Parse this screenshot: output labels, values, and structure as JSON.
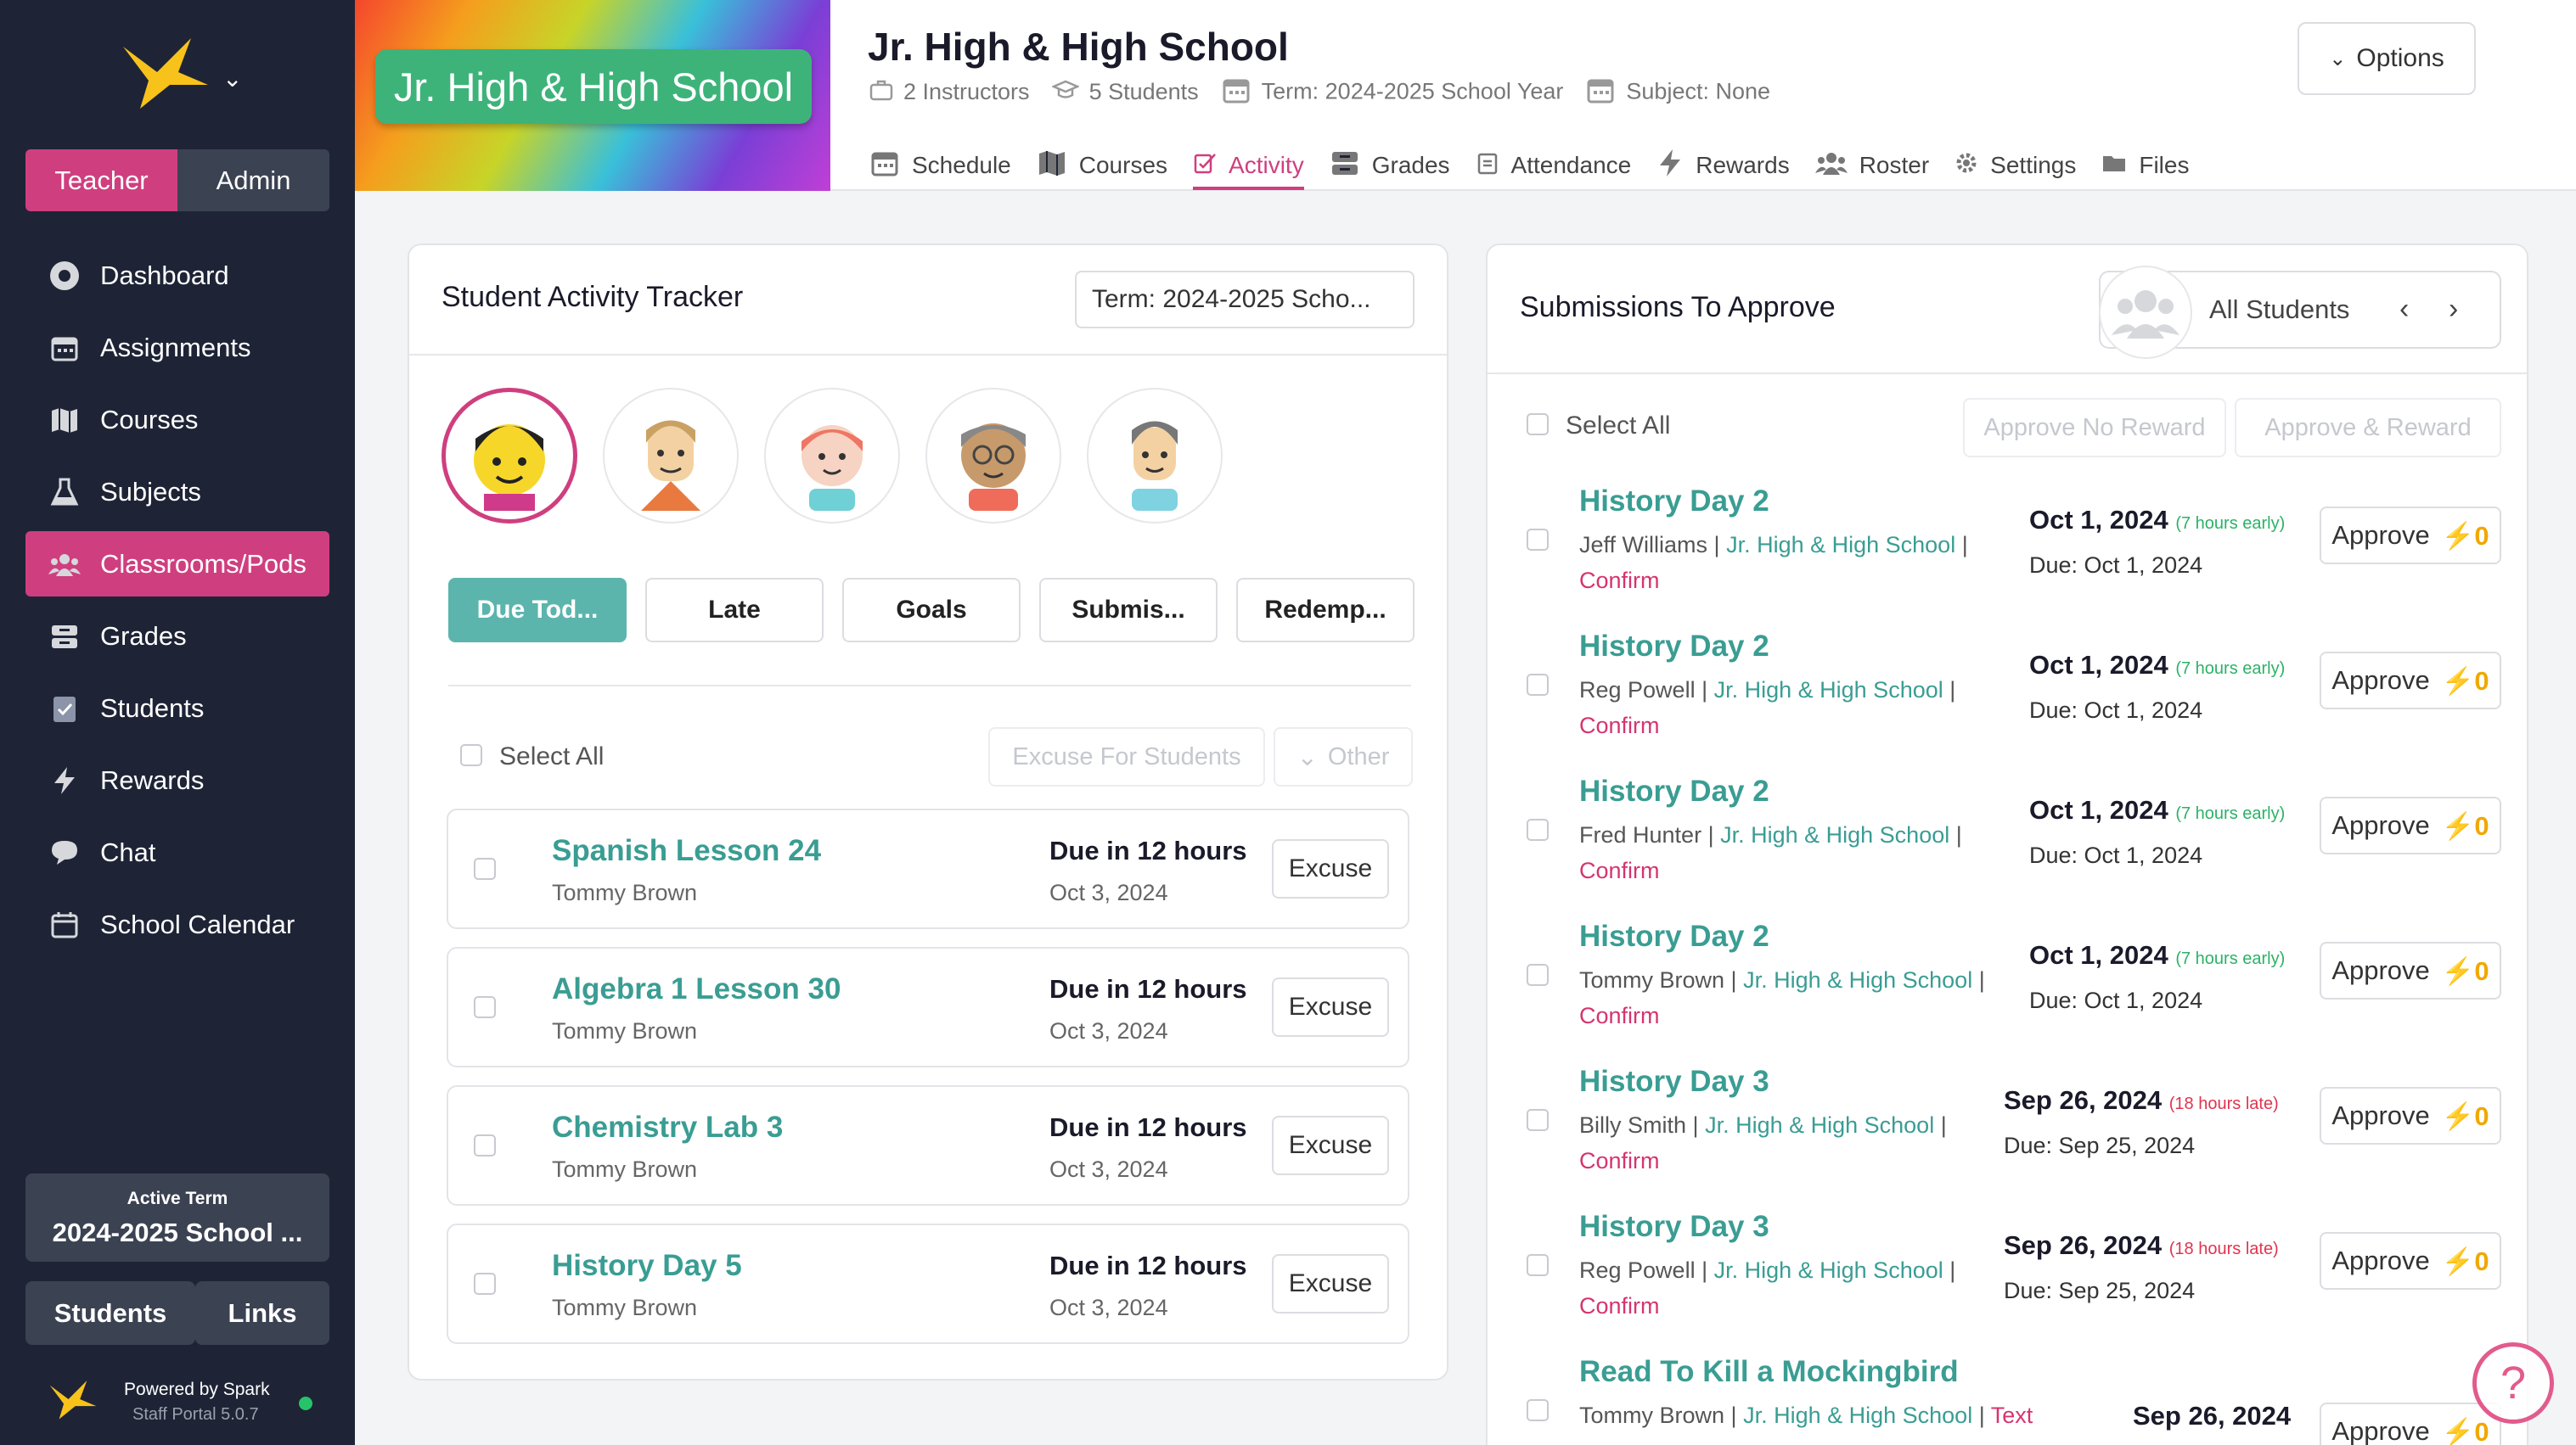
{
  "sidebar": {
    "roles": [
      "Teacher",
      "Admin"
    ],
    "nav": [
      {
        "label": "Dashboard",
        "icon": "dashboard-icon"
      },
      {
        "label": "Assignments",
        "icon": "calendar-icon"
      },
      {
        "label": "Courses",
        "icon": "map-icon"
      },
      {
        "label": "Subjects",
        "icon": "flask-icon"
      },
      {
        "label": "Classrooms/Pods",
        "icon": "users-icon",
        "active": true
      },
      {
        "label": "Grades",
        "icon": "inbox-icon"
      },
      {
        "label": "Students",
        "icon": "clipboard-check-icon"
      },
      {
        "label": "Rewards",
        "icon": "bolt-icon"
      },
      {
        "label": "Chat",
        "icon": "chat-icon"
      },
      {
        "label": "School Calendar",
        "icon": "calendar-outline-icon"
      }
    ],
    "active_term_label": "Active Term",
    "active_term_value": "2024-2025 School ...",
    "students_btn": "Students",
    "links_btn": "Links",
    "powered_by": "Powered by Spark",
    "version": "Staff Portal 5.0.7"
  },
  "header": {
    "banner_text": "Jr. High & High School",
    "title": "Jr. High & High School",
    "meta": [
      {
        "icon": "briefcase-icon",
        "text": "2 Instructors"
      },
      {
        "icon": "graduation-cap-icon",
        "text": "5 Students"
      },
      {
        "icon": "calendar-icon",
        "text": "Term: 2024-2025 School Year"
      },
      {
        "icon": "calendar-icon",
        "text": "Subject: None"
      }
    ],
    "tabs": [
      {
        "label": "Schedule",
        "icon": "calendar-icon"
      },
      {
        "label": "Courses",
        "icon": "map-icon"
      },
      {
        "label": "Activity",
        "icon": "activity-icon",
        "active": true
      },
      {
        "label": "Grades",
        "icon": "inbox-icon"
      },
      {
        "label": "Attendance",
        "icon": "clipboard-icon"
      },
      {
        "label": "Rewards",
        "icon": "bolt-icon"
      },
      {
        "label": "Roster",
        "icon": "users-icon"
      },
      {
        "label": "Settings",
        "icon": "gear-icon"
      },
      {
        "label": "Files",
        "icon": "folder-icon"
      }
    ],
    "options_label": "Options"
  },
  "tracker": {
    "title": "Student Activity Tracker",
    "term_select": "Term: 2024-2025 Scho...",
    "filters": [
      "Due Tod...",
      "Late",
      "Goals",
      "Submis...",
      "Redemp..."
    ],
    "select_all": "Select All",
    "excuse_students": "Excuse For Students",
    "other": "Other",
    "items": [
      {
        "title": "Spanish Lesson 24",
        "student": "Tommy Brown",
        "due": "Due in 12 hours",
        "date": "Oct 3, 2024",
        "action": "Excuse"
      },
      {
        "title": "Algebra 1 Lesson 30",
        "student": "Tommy Brown",
        "due": "Due in 12 hours",
        "date": "Oct 3, 2024",
        "action": "Excuse"
      },
      {
        "title": "Chemistry Lab 3",
        "student": "Tommy Brown",
        "due": "Due in 12 hours",
        "date": "Oct 3, 2024",
        "action": "Excuse"
      },
      {
        "title": "History Day 5",
        "student": "Tommy Brown",
        "due": "Due in 12 hours",
        "date": "Oct 3, 2024",
        "action": "Excuse"
      }
    ]
  },
  "submissions": {
    "title": "Submissions To Approve",
    "filter_label": "All Students",
    "select_all": "Select All",
    "approve_no_reward": "Approve No Reward",
    "approve_reward": "Approve & Reward",
    "items": [
      {
        "title": "History Day 2",
        "student": "Jeff Williams",
        "class": "Jr. High & High School",
        "status": "Confirm",
        "date": "Oct 1, 2024",
        "rel": "(7 hours early)",
        "rel_type": "early",
        "due": "Due: Oct 1, 2024",
        "approve": "Approve",
        "points": "0"
      },
      {
        "title": "History Day 2",
        "student": "Reg Powell",
        "class": "Jr. High & High School",
        "status": "Confirm",
        "date": "Oct 1, 2024",
        "rel": "(7 hours early)",
        "rel_type": "early",
        "due": "Due: Oct 1, 2024",
        "approve": "Approve",
        "points": "0"
      },
      {
        "title": "History Day 2",
        "student": "Fred Hunter",
        "class": "Jr. High & High School",
        "status": "Confirm",
        "date": "Oct 1, 2024",
        "rel": "(7 hours early)",
        "rel_type": "early",
        "due": "Due: Oct 1, 2024",
        "approve": "Approve",
        "points": "0"
      },
      {
        "title": "History Day 2",
        "student": "Tommy Brown",
        "class": "Jr. High & High School",
        "status": "Confirm",
        "date": "Oct 1, 2024",
        "rel": "(7 hours early)",
        "rel_type": "early",
        "due": "Due: Oct 1, 2024",
        "approve": "Approve",
        "points": "0"
      },
      {
        "title": "History Day 3",
        "student": "Billy Smith",
        "class": "Jr. High & High School",
        "status": "Confirm",
        "date": "Sep 26, 2024",
        "rel": "(18 hours late)",
        "rel_type": "late",
        "due": "Due: Sep 25, 2024",
        "approve": "Approve",
        "points": "0"
      },
      {
        "title": "History Day 3",
        "student": "Reg Powell",
        "class": "Jr. High & High School",
        "status": "Confirm",
        "date": "Sep 26, 2024",
        "rel": "(18 hours late)",
        "rel_type": "late",
        "due": "Due: Sep 25, 2024",
        "approve": "Approve",
        "points": "0"
      },
      {
        "title": "Read To Kill a Mockingbird",
        "student": "Tommy Brown",
        "class": "Jr. High & High School",
        "status": "Text",
        "date": "Sep 26, 2024",
        "rel": "",
        "rel_type": "",
        "due": "",
        "approve": "Approve",
        "points": "0"
      }
    ]
  },
  "help_label": "?",
  "colors": {
    "accent": "#cf3f7f",
    "teal": "#5bb5ad",
    "link": "#3a9d93",
    "sidebar": "#1e2436",
    "points": "#f0a800"
  }
}
